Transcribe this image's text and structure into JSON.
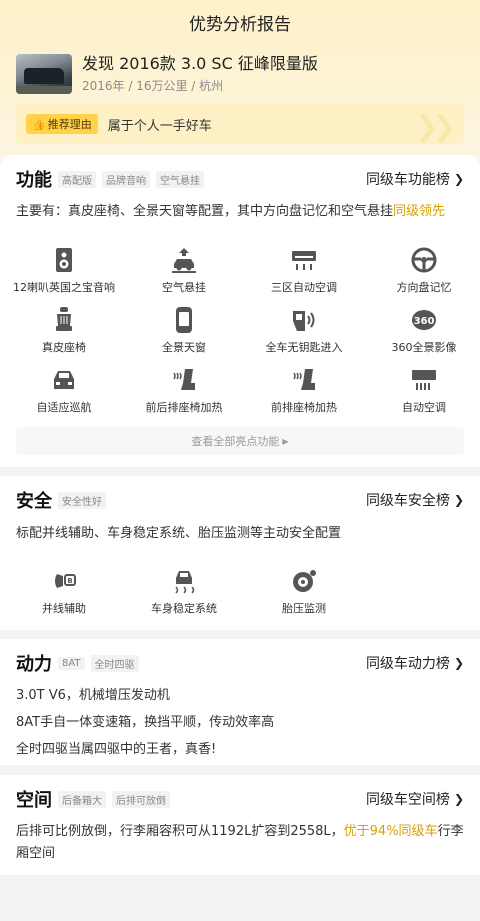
{
  "topbar": {
    "title": "优势分析报告"
  },
  "car": {
    "title": "发现 2016款 3.0 SC 征峰限量版",
    "sub": "2016年 / 16万公里 / 杭州"
  },
  "reason": {
    "badge": "推荐理由",
    "text": "属于个人一手好车"
  },
  "features": {
    "title": "功能",
    "tags": [
      "高配版",
      "品牌音响",
      "空气悬挂"
    ],
    "rank_label": "同级车功能榜",
    "desc_main": "主要有：真皮座椅、全景天窗等配置，其中方向盘记忆和空气悬挂",
    "desc_highlight": "同级领先",
    "items": [
      {
        "label": "12喇叭英国之宝音响",
        "icon": "speaker-icon"
      },
      {
        "label": "空气悬挂",
        "icon": "air-suspension-icon"
      },
      {
        "label": "三区自动空调",
        "icon": "tri-zone-ac-icon"
      },
      {
        "label": "方向盘记忆",
        "icon": "steering-wheel-icon"
      },
      {
        "label": "真皮座椅",
        "icon": "leather-seat-icon"
      },
      {
        "label": "全景天窗",
        "icon": "panoramic-roof-icon"
      },
      {
        "label": "全车无钥匙进入",
        "icon": "keyless-entry-icon"
      },
      {
        "label": "360全景影像",
        "icon": "camera-360-icon"
      },
      {
        "label": "自适应巡航",
        "icon": "adaptive-cruise-icon"
      },
      {
        "label": "前后排座椅加热",
        "icon": "seat-heat-both-icon"
      },
      {
        "label": "前排座椅加热",
        "icon": "seat-heat-front-icon"
      },
      {
        "label": "自动空调",
        "icon": "auto-ac-icon"
      }
    ],
    "more_label": "查看全部亮点功能"
  },
  "safety": {
    "title": "安全",
    "tags": [
      "安全性好"
    ],
    "rank_label": "同级车安全榜",
    "desc": "标配并线辅助、车身稳定系统、胎压监测等主动安全配置",
    "items": [
      {
        "label": "并线辅助",
        "icon": "lane-assist-icon"
      },
      {
        "label": "车身稳定系统",
        "icon": "stability-control-icon"
      },
      {
        "label": "胎压监测",
        "icon": "tire-pressure-icon"
      }
    ]
  },
  "power": {
    "title": "动力",
    "tags": [
      "8AT",
      "全时四驱"
    ],
    "rank_label": "同级车动力榜",
    "lines": [
      "3.0T V6，机械增压发动机",
      "8AT手自一体变速箱，换挡平顺，传动效率高",
      "全时四驱当属四驱中的王者，真香!"
    ]
  },
  "space": {
    "title": "空间",
    "tags": [
      "后备箱大",
      "后排可放倒"
    ],
    "rank_label": "同级车空间榜",
    "desc_main": "后排可比例放倒，行李厢容积可从1192L扩容到2558L，",
    "desc_highlight": "优于94%同级车",
    "desc_tail": "行李厢空间"
  },
  "colors": {
    "accent": "#d9a000",
    "badge": "#ffd24a"
  }
}
